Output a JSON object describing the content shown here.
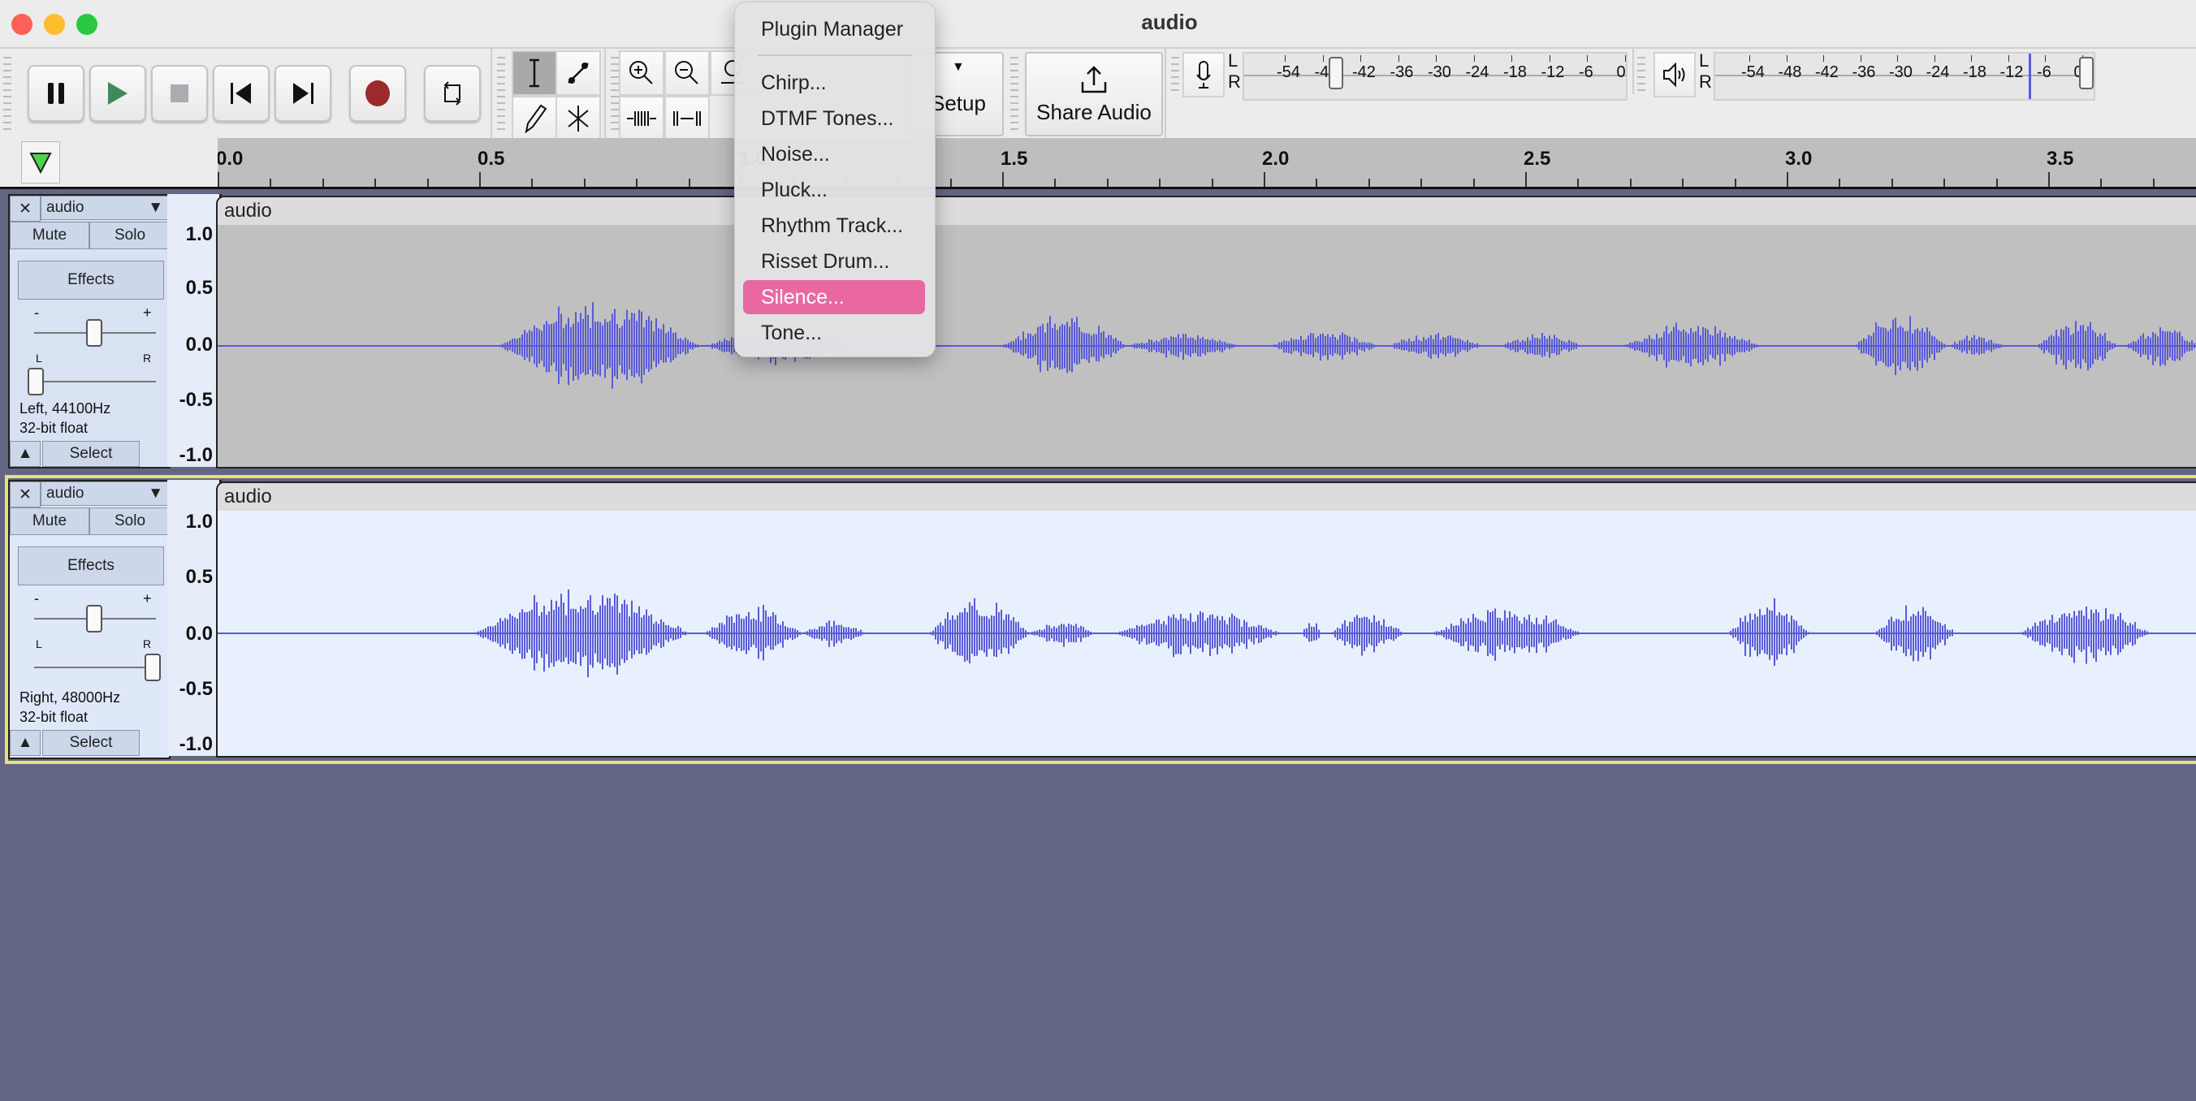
{
  "window": {
    "title": "audio"
  },
  "transport": {
    "buttons": [
      "pause",
      "play",
      "stop",
      "skip-to-start",
      "skip-to-end",
      "record",
      "loop"
    ]
  },
  "audio_setup": {
    "label": "Setup"
  },
  "share": {
    "label": "Share Audio"
  },
  "recording_meter": {
    "channels": [
      "L",
      "R"
    ],
    "scale": [
      "-54",
      "-48",
      "-42",
      "-36",
      "-30",
      "-24",
      "-18",
      "-12",
      "-6",
      "0"
    ],
    "slider_value_db": -45
  },
  "playback_meter": {
    "channels": [
      "L",
      "R"
    ],
    "scale": [
      "-54",
      "-48",
      "-42",
      "-36",
      "-30",
      "-24",
      "-18",
      "-12",
      "-6",
      "0"
    ],
    "slider_value_db": 0,
    "level_db": -10
  },
  "ruler": {
    "labels": [
      "0.0",
      "0.5",
      "1.0",
      "1.5",
      "2.0",
      "2.5",
      "3.0",
      "3.5"
    ]
  },
  "tracks": [
    {
      "name": "audio",
      "clip_name": "audio",
      "mute": "Mute",
      "solo": "Solo",
      "effects": "Effects",
      "gain_min": "-",
      "gain_max": "+",
      "pan_left": "L",
      "pan_right": "R",
      "pan_value": -1.0,
      "gain_value": 0.5,
      "info1": "Left, 44100Hz",
      "info2": "32-bit float",
      "select": "Select",
      "scale": [
        "1.0",
        "0.5",
        "0.0",
        "-0.5",
        "-1.0"
      ],
      "selected": false
    },
    {
      "name": "audio",
      "clip_name": "audio",
      "mute": "Mute",
      "solo": "Solo",
      "effects": "Effects",
      "gain_min": "-",
      "gain_max": "+",
      "pan_left": "L",
      "pan_right": "R",
      "pan_value": 1.0,
      "gain_value": 0.5,
      "info1": "Right, 48000Hz",
      "info2": "32-bit float",
      "select": "Select",
      "scale": [
        "1.0",
        "0.5",
        "0.0",
        "-0.5",
        "-1.0"
      ],
      "selected": true
    }
  ],
  "menu": {
    "items": [
      "Plugin Manager",
      "Chirp...",
      "DTMF Tones...",
      "Noise...",
      "Pluck...",
      "Rhythm Track...",
      "Risset Drum...",
      "Silence...",
      "Tone..."
    ],
    "highlighted": "Silence..."
  },
  "colors": {
    "waveform": "#5a5ad8",
    "menu_highlight": "#ea68a2",
    "selected_track_border": "#e8e07a",
    "background": "#636682"
  }
}
